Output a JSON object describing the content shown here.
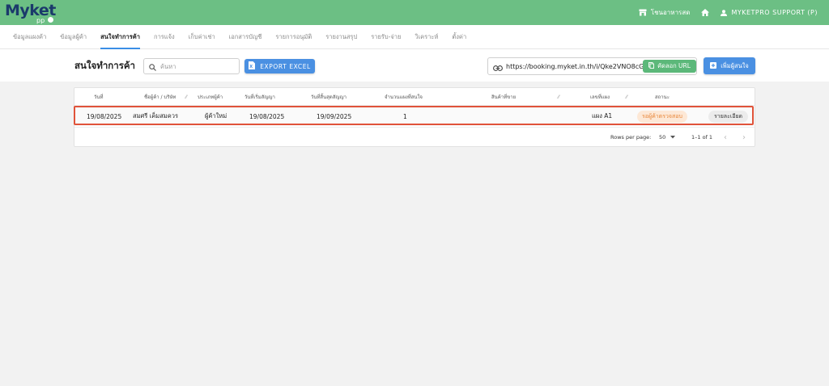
{
  "header": {
    "logo_text": "Myket",
    "logo_sub": "pp",
    "store_label": "โชนอาหารสด",
    "user_label": "MYKETPRO SUPPORT (P)",
    "bg_color": "#6cbf84"
  },
  "nav": {
    "tabs": [
      {
        "label": "ข้อมูลแผงค้า",
        "active": false
      },
      {
        "label": "ข้อมูลผู้ค้า",
        "active": false
      },
      {
        "label": "สนใจทำการค้า",
        "active": true
      },
      {
        "label": "การแจ้ง",
        "active": false
      },
      {
        "label": "เก็บค่าเช่า",
        "active": false
      },
      {
        "label": "เอกสารบัญชี",
        "active": false
      },
      {
        "label": "รายการอนุมัติ",
        "active": false
      },
      {
        "label": "รายงานสรุป",
        "active": false
      },
      {
        "label": "รายรับ-จ่าย",
        "active": false
      },
      {
        "label": "วิเคราะห์",
        "active": false
      },
      {
        "label": "ตั้งค่า",
        "active": false
      }
    ]
  },
  "toolbar": {
    "title": "สนใจทำการค้า",
    "search_placeholder": "ค้นหา",
    "export_label": "EXPORT EXCEL",
    "url_value": "https://booking.myket.in.th/i/Qke2VNO8cG7i",
    "copy_label": "คัดลอก URL",
    "add_label": "เพิ่มผู้สนใจ",
    "accent_color": "#4a90e2",
    "copy_color": "#5cb87a"
  },
  "table": {
    "columns": [
      "วันที่",
      "ชื่อผู้ค้า / บริษัท",
      "ประเภทผู้ค้า",
      "วันที่เริ่มสัญญา",
      "วันที่สิ้นสุดสัญญา",
      "จำนวนแผงที่สนใจ",
      "สินค้าที่ขาย",
      "เลขที่แผง",
      "สถานะ"
    ],
    "rows": [
      {
        "date": "19/08/2025",
        "name": "สมศรี เค็มสมควร",
        "type": "ผู้ค้าใหม่",
        "start": "19/08/2025",
        "end": "19/09/2025",
        "count": "1",
        "product": "",
        "stall": "แผง A1",
        "status": "รอผู้ค้าตรวจสอบ",
        "action": "รายละเอียด"
      }
    ],
    "footer": {
      "rows_per_page_label": "Rows per page:",
      "rows_per_page_value": "50",
      "range_label": "1–1 of 1"
    },
    "status_color": "#e8873a",
    "highlight_color": "#e0533a"
  }
}
